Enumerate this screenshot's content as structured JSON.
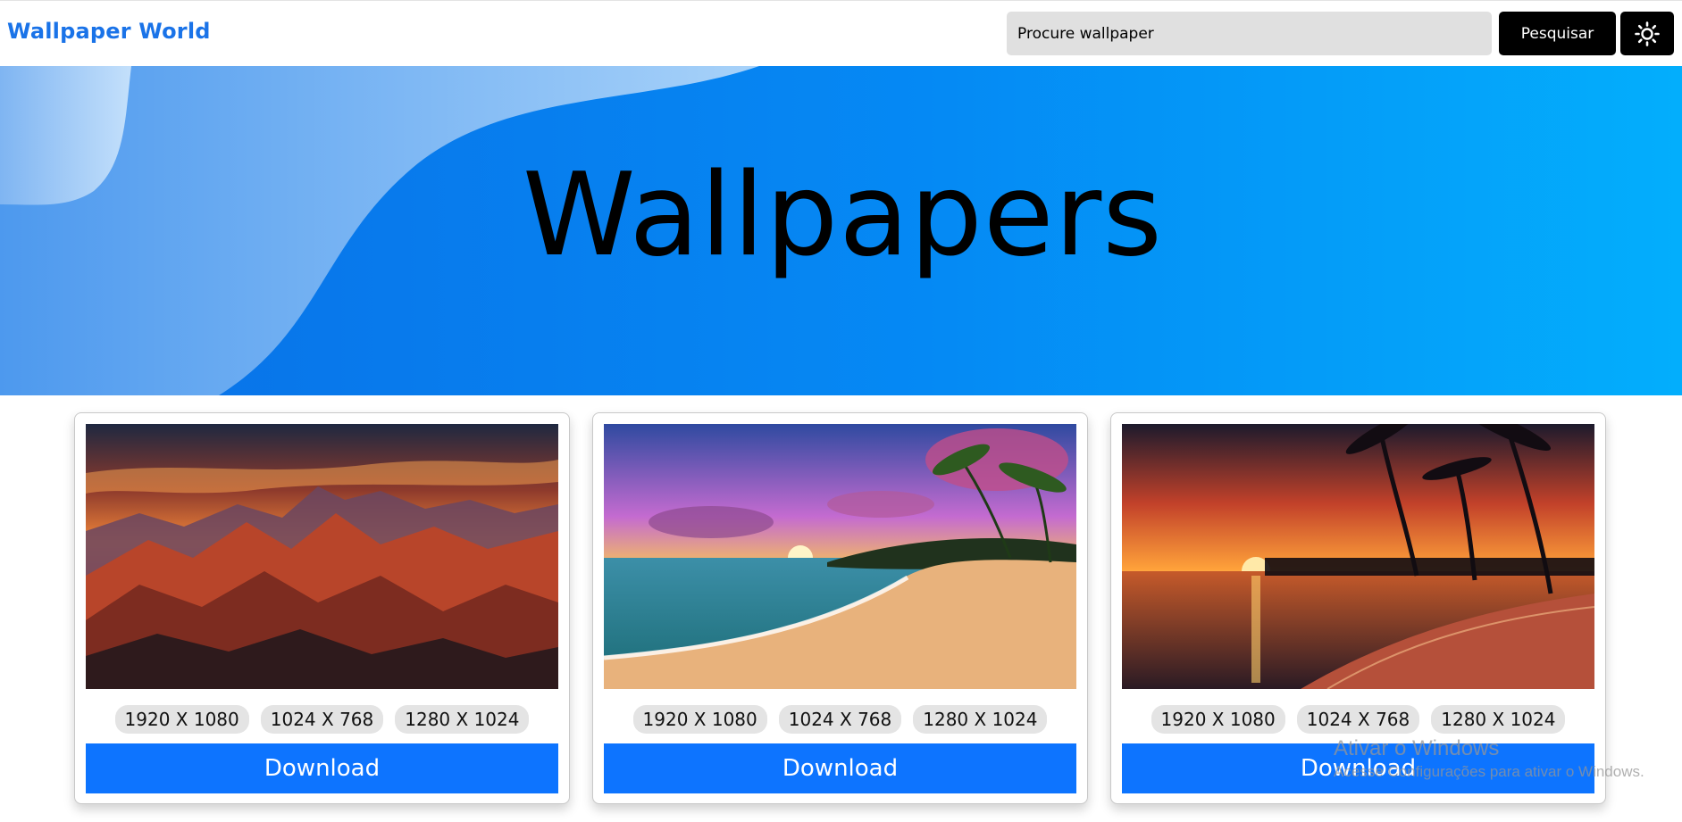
{
  "header": {
    "logo": "Wallpaper World",
    "search_placeholder": "Procure wallpaper",
    "search_button": "Pesquisar",
    "theme_icon": "sun-icon"
  },
  "hero": {
    "title": "Wallpapers"
  },
  "cards": [
    {
      "image": "mountain-sunset-image",
      "sizes": [
        "1920 X 1080",
        "1024 X 768",
        "1280 X 1024"
      ],
      "download": "Download"
    },
    {
      "image": "beach-sunset-image",
      "sizes": [
        "1920 X 1080",
        "1024 X 768",
        "1280 X 1024"
      ],
      "download": "Download"
    },
    {
      "image": "palm-beach-sunset-image",
      "sizes": [
        "1920 X 1080",
        "1024 X 768",
        "1280 X 1024"
      ],
      "download": "Download"
    }
  ],
  "watermark": {
    "title": "Ativar o Windows",
    "subtitle": "Acesse Configurações para ativar o Windows."
  },
  "colors": {
    "brand": "#1a73e8",
    "hero_gradient_start": "#0a6fe6",
    "hero_gradient_end": "#03aefc",
    "download_button": "#0d74ff",
    "search_button": "#000000"
  }
}
